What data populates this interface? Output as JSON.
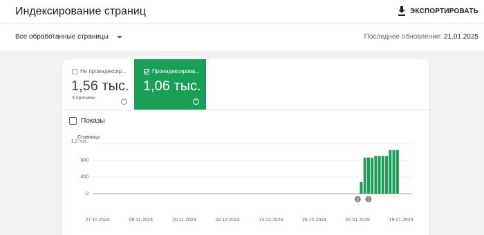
{
  "header": {
    "title": "Индексирование страниц",
    "export_label": "ЭКСПОРТИРОВАТЬ"
  },
  "filter": {
    "selected": "Все обработанные страницы",
    "last_update_label": "Последнее обновление:",
    "last_update_date": "21.01.2025"
  },
  "tiles": [
    {
      "label": "Не проиндексир...",
      "value": "1,56 тыс.",
      "sub": "3 причины",
      "checked": false
    },
    {
      "label": "Проиндексирова...",
      "value": "1,06 тыс.",
      "sub": "",
      "checked": true
    }
  ],
  "impressions_label": "Показы",
  "chart_data": {
    "type": "bar",
    "ylabel": "Страницы",
    "ytick_labels": [
      "1,2 тыс.",
      "800",
      "400",
      "0"
    ],
    "yticks": [
      1200,
      800,
      400,
      0
    ],
    "ylim": [
      0,
      1200
    ],
    "xtick_labels": [
      "27.10.2024",
      "08.11.2024",
      "20.11.2024",
      "02.12.2024",
      "14.12.2024",
      "26.12.2024",
      "07.01.2025",
      "19.01.2025"
    ],
    "series": [
      {
        "color": "#1a9f57",
        "values": [
          {
            "x": "08.01.2025",
            "y": 280
          },
          {
            "x": "09.01.2025",
            "y": 860
          },
          {
            "x": "10.01.2025",
            "y": 860
          },
          {
            "x": "11.01.2025",
            "y": 860
          },
          {
            "x": "12.01.2025",
            "y": 900
          },
          {
            "x": "13.01.2025",
            "y": 900
          },
          {
            "x": "14.01.2025",
            "y": 900
          },
          {
            "x": "15.01.2025",
            "y": 900
          },
          {
            "x": "16.01.2025",
            "y": 1040
          },
          {
            "x": "17.01.2025",
            "y": 1040
          },
          {
            "x": "18.01.2025",
            "y": 1040
          }
        ]
      }
    ],
    "annotations": [
      {
        "label": "2",
        "x": "07.01.2025"
      },
      {
        "label": "1",
        "x": "10.01.2025"
      }
    ],
    "grid": true
  }
}
